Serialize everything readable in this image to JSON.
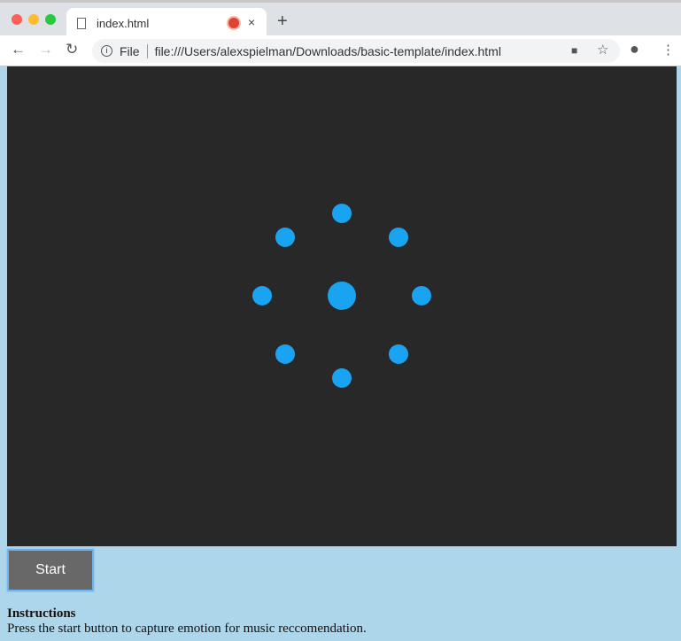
{
  "browser": {
    "tab_title": "index.html",
    "new_tab": "+",
    "tab_close": "×",
    "omnibox_scheme": "File",
    "url": "file:///Users/alexspielman/Downloads/basic-template/index.html",
    "traffic_colors": [
      "#fe5f57",
      "#febc2e",
      "#28c840"
    ]
  },
  "page": {
    "canvas_color": "#282828",
    "spinner_color": "#1aa3f0",
    "start_label": "Start",
    "instructions_title": "Instructions",
    "instructions_text": "Press the start button to capture emotion for music reccomendation."
  }
}
